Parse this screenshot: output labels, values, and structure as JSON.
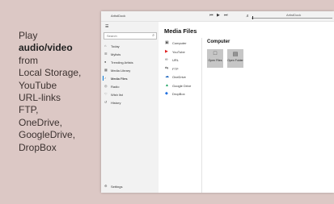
{
  "promo": {
    "line1": "Play",
    "line2": "audio/video",
    "line3": "from",
    "line4": "Local Storage,",
    "line5": "YouTube",
    "line6": "URL-links",
    "line7": "FTP,",
    "line8": "OneDrive,",
    "line9": "GoogleDrive,",
    "line10": "DropBox"
  },
  "window": {
    "title": "ArtistDock"
  },
  "player": {
    "track_title": "ArtistDock",
    "prev_icon": "previous-icon",
    "play_icon": "play-pause-icon",
    "next_icon": "next-icon",
    "volume_icon": "volume-icon"
  },
  "sidebar": {
    "search_placeholder": "Search",
    "items": [
      {
        "label": "Today",
        "icon": "home-icon"
      },
      {
        "label": "Mylists",
        "icon": "list-icon"
      },
      {
        "label": "Trending Artists",
        "icon": "people-icon"
      },
      {
        "label": "Media Library",
        "icon": "library-icon"
      },
      {
        "label": "Media Files",
        "icon": "note-icon",
        "active": true
      },
      {
        "label": "Radio",
        "icon": "radio-icon"
      },
      {
        "label": "Wish list",
        "icon": "heart-icon"
      },
      {
        "label": "History",
        "icon": "history-icon"
      }
    ],
    "settings_label": "Settings"
  },
  "content": {
    "title": "Media Files",
    "sources": [
      {
        "label": "Computer",
        "icon": "computer-icon",
        "color": "#555555"
      },
      {
        "label": "YouTube",
        "icon": "youtube-icon",
        "color": "#e02020"
      },
      {
        "label": "URL",
        "icon": "link-icon",
        "color": "#555555"
      },
      {
        "label": "FTP",
        "icon": "ftp-icon",
        "color": "#555555"
      },
      {
        "label": "OneDrive",
        "icon": "onedrive-icon",
        "color": "#0a58b8"
      },
      {
        "label": "Google Drive",
        "icon": "google-drive-icon",
        "color": "#1aa260"
      },
      {
        "label": "DropBox",
        "icon": "dropbox-icon",
        "color": "#1f6fe0"
      }
    ],
    "pane_title": "Computer",
    "tiles": [
      {
        "label": "Open Files",
        "icon": "file-icon"
      },
      {
        "label": "Open Folder",
        "icon": "folder-icon"
      }
    ]
  },
  "colors": {
    "accent": "#0078d7",
    "background": "#dcc8c5",
    "tile": "#c6c6c6"
  }
}
